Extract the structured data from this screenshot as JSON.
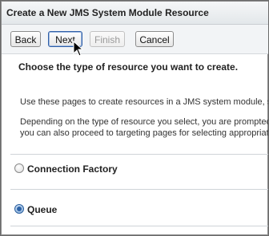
{
  "window": {
    "title": "Create a New JMS System Module Resource"
  },
  "toolbar": {
    "back_label": "Back",
    "next_label": "Next",
    "finish_label": "Finish",
    "cancel_label": "Cancel"
  },
  "content": {
    "heading": "Choose the type of resource you want to create.",
    "paragraph1": "Use these pages to create resources in a JMS system module, s",
    "paragraph2_line1": "Depending on the type of resource you select, you are prompted",
    "paragraph2_line2": "you can also proceed to targeting pages for selecting appropriate"
  },
  "resource_types": [
    {
      "label": "Connection Factory",
      "selected": false
    },
    {
      "label": "Queue",
      "selected": true
    }
  ]
}
